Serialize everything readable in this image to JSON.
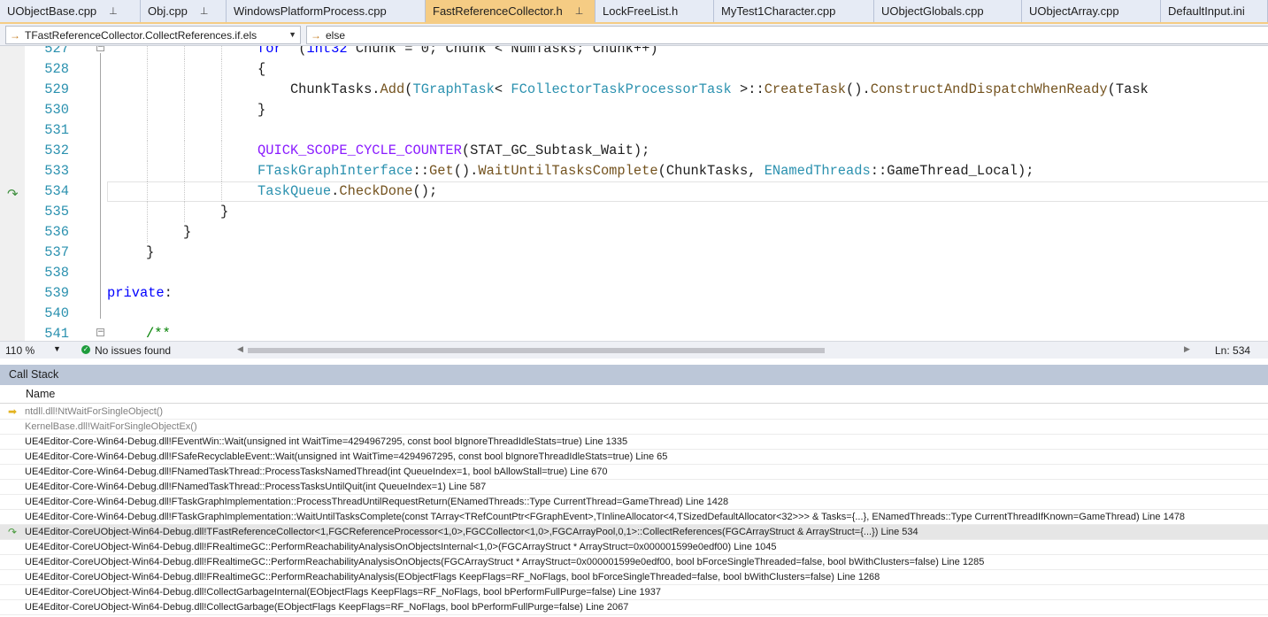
{
  "tabs": [
    {
      "label": "UObjectBase.cpp",
      "pinned": true,
      "active": false
    },
    {
      "label": "Obj.cpp",
      "pinned": true,
      "active": false
    },
    {
      "label": "WindowsPlatformProcess.cpp",
      "pinned": false,
      "active": false
    },
    {
      "label": "FastReferenceCollector.h",
      "pinned": true,
      "active": true
    },
    {
      "label": "LockFreeList.h",
      "pinned": false,
      "active": false
    },
    {
      "label": "MyTest1Character.cpp",
      "pinned": false,
      "active": false
    },
    {
      "label": "UObjectGlobals.cpp",
      "pinned": false,
      "active": false
    },
    {
      "label": "UObjectArray.cpp",
      "pinned": false,
      "active": false
    },
    {
      "label": "DefaultInput.ini",
      "pinned": false,
      "active": false
    }
  ],
  "nav": {
    "scope": "TFastReferenceCollector.CollectReferences.if.els",
    "member": "else"
  },
  "editor": {
    "lines": [
      {
        "n": "527",
        "tokens": [
          [
            "kw",
            "for"
          ],
          [
            "",
            "  ("
          ],
          [
            "kw",
            "int32"
          ],
          [
            "",
            " Chunk = 0; Chunk < NumTasks; Chunk++)"
          ]
        ]
      },
      {
        "n": "528",
        "tokens": [
          [
            "",
            "{"
          ]
        ]
      },
      {
        "n": "529",
        "tokens": [
          [
            "",
            "    ChunkTasks."
          ],
          [
            "fn",
            "Add"
          ],
          [
            "",
            "("
          ],
          [
            "ty",
            "TGraphTask"
          ],
          [
            "",
            "< "
          ],
          [
            "ty",
            "FCollectorTaskProcessorTask"
          ],
          [
            "",
            " >::"
          ],
          [
            "fn",
            "CreateTask"
          ],
          [
            "",
            "()."
          ],
          [
            "fn",
            "ConstructAndDispatchWhenReady"
          ],
          [
            "",
            "(Task"
          ]
        ]
      },
      {
        "n": "530",
        "tokens": [
          [
            "",
            "}"
          ]
        ]
      },
      {
        "n": "531",
        "tokens": []
      },
      {
        "n": "532",
        "tokens": [
          [
            "mac",
            "QUICK_SCOPE_CYCLE_COUNTER"
          ],
          [
            "",
            "(STAT_GC_Subtask_Wait);"
          ]
        ]
      },
      {
        "n": "533",
        "tokens": [
          [
            "ty",
            "FTaskGraphInterface"
          ],
          [
            "",
            "::"
          ],
          [
            "fn",
            "Get"
          ],
          [
            "",
            "()."
          ],
          [
            "fn",
            "WaitUntilTasksComplete"
          ],
          [
            "",
            "(ChunkTasks, "
          ],
          [
            "ty",
            "ENamedThreads"
          ],
          [
            "",
            "::GameThread_Local);"
          ]
        ]
      },
      {
        "n": "534",
        "tokens": [
          [
            "ty",
            "TaskQueue"
          ],
          [
            "",
            "."
          ],
          [
            "fn",
            "CheckDone"
          ],
          [
            "",
            "();"
          ]
        ]
      },
      {
        "n": "535",
        "tokens": [
          [
            "",
            "}"
          ]
        ]
      },
      {
        "n": "536",
        "tokens": [
          [
            "",
            "}"
          ]
        ]
      },
      {
        "n": "537",
        "tokens": [
          [
            "",
            "}"
          ]
        ]
      },
      {
        "n": "538",
        "tokens": []
      },
      {
        "n": "539",
        "tokens": [
          [
            "kw",
            "private"
          ],
          [
            "",
            ":"
          ]
        ]
      },
      {
        "n": "540",
        "tokens": []
      },
      {
        "n": "541",
        "tokens": [
          [
            "cm",
            "/**"
          ]
        ]
      }
    ]
  },
  "status": {
    "zoom": "110 %",
    "issues": "No issues found",
    "position": "Ln: 534"
  },
  "callstack": {
    "title": "Call Stack",
    "column": "Name",
    "frames": [
      {
        "text": "ntdll.dll!NtWaitForSingleObject()",
        "marker": "current",
        "dim": true,
        "selected": false
      },
      {
        "text": "KernelBase.dll!WaitForSingleObjectEx()",
        "marker": "",
        "dim": true,
        "selected": false
      },
      {
        "text": "UE4Editor-Core-Win64-Debug.dll!FEventWin::Wait(unsigned int WaitTime=4294967295, const bool bIgnoreThreadIdleStats=true) Line 1335",
        "marker": "",
        "dim": false,
        "selected": false
      },
      {
        "text": "UE4Editor-Core-Win64-Debug.dll!FSafeRecyclableEvent::Wait(unsigned int WaitTime=4294967295, const bool bIgnoreThreadIdleStats=true) Line 65",
        "marker": "",
        "dim": false,
        "selected": false
      },
      {
        "text": "UE4Editor-Core-Win64-Debug.dll!FNamedTaskThread::ProcessTasksNamedThread(int QueueIndex=1, bool bAllowStall=true) Line 670",
        "marker": "",
        "dim": false,
        "selected": false
      },
      {
        "text": "UE4Editor-Core-Win64-Debug.dll!FNamedTaskThread::ProcessTasksUntilQuit(int QueueIndex=1) Line 587",
        "marker": "",
        "dim": false,
        "selected": false
      },
      {
        "text": "UE4Editor-Core-Win64-Debug.dll!FTaskGraphImplementation::ProcessThreadUntilRequestReturn(ENamedThreads::Type CurrentThread=GameThread) Line 1428",
        "marker": "",
        "dim": false,
        "selected": false
      },
      {
        "text": "UE4Editor-Core-Win64-Debug.dll!FTaskGraphImplementation::WaitUntilTasksComplete(const TArray<TRefCountPtr<FGraphEvent>,TInlineAllocator<4,TSizedDefaultAllocator<32>>> & Tasks={...}, ENamedThreads::Type CurrentThreadIfKnown=GameThread) Line 1478",
        "marker": "",
        "dim": false,
        "selected": false
      },
      {
        "text": "UE4Editor-CoreUObject-Win64-Debug.dll!TFastReferenceCollector<1,FGCReferenceProcessor<1,0>,FGCCollector<1,0>,FGCArrayPool,0,1>::CollectReferences(FGCArrayStruct & ArrayStruct={...}) Line 534",
        "marker": "frame",
        "dim": false,
        "selected": true
      },
      {
        "text": "UE4Editor-CoreUObject-Win64-Debug.dll!FRealtimeGC::PerformReachabilityAnalysisOnObjectsInternal<1,0>(FGCArrayStruct * ArrayStruct=0x000001599e0edf00) Line 1045",
        "marker": "",
        "dim": false,
        "selected": false
      },
      {
        "text": "UE4Editor-CoreUObject-Win64-Debug.dll!FRealtimeGC::PerformReachabilityAnalysisOnObjects(FGCArrayStruct * ArrayStruct=0x000001599e0edf00, bool bForceSingleThreaded=false, bool bWithClusters=false) Line 1285",
        "marker": "",
        "dim": false,
        "selected": false
      },
      {
        "text": "UE4Editor-CoreUObject-Win64-Debug.dll!FRealtimeGC::PerformReachabilityAnalysis(EObjectFlags KeepFlags=RF_NoFlags, bool bForceSingleThreaded=false, bool bWithClusters=false) Line 1268",
        "marker": "",
        "dim": false,
        "selected": false
      },
      {
        "text": "UE4Editor-CoreUObject-Win64-Debug.dll!CollectGarbageInternal(EObjectFlags KeepFlags=RF_NoFlags, bool bPerformFullPurge=false) Line 1937",
        "marker": "",
        "dim": false,
        "selected": false
      },
      {
        "text": "UE4Editor-CoreUObject-Win64-Debug.dll!CollectGarbage(EObjectFlags KeepFlags=RF_NoFlags, bool bPerformFullPurge=false) Line 2067",
        "marker": "",
        "dim": false,
        "selected": false
      }
    ]
  }
}
